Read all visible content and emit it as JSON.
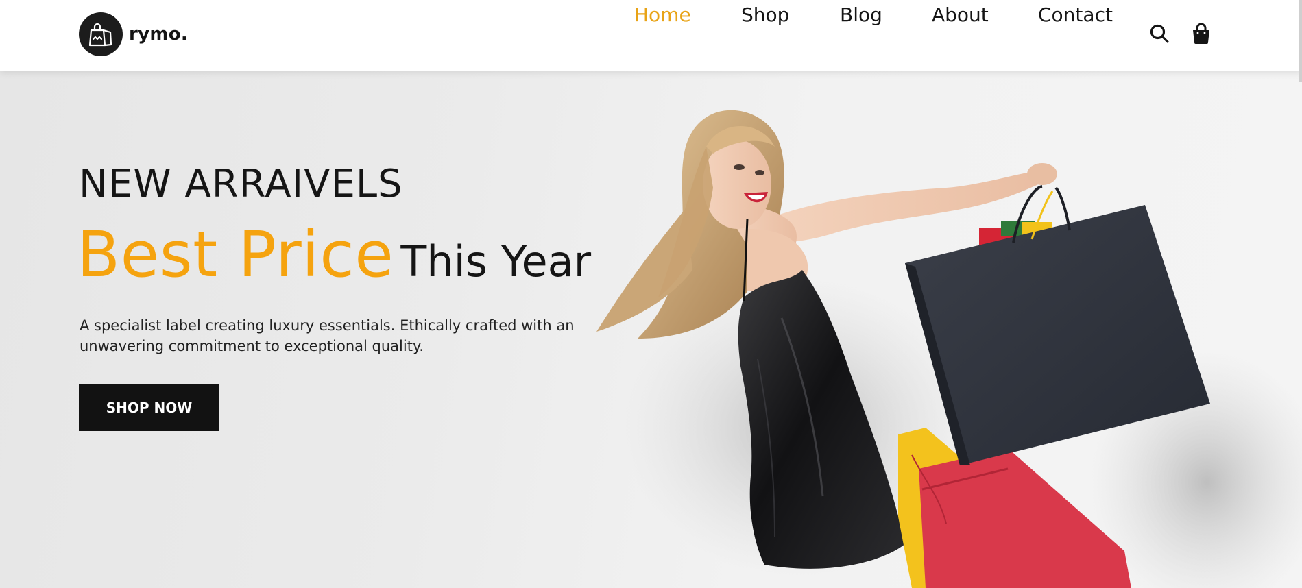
{
  "brand": {
    "name": "rymo."
  },
  "nav": {
    "items": [
      {
        "label": "Home",
        "active": true
      },
      {
        "label": "Shop",
        "active": false
      },
      {
        "label": "Blog",
        "active": false
      },
      {
        "label": "About",
        "active": false
      },
      {
        "label": "Contact",
        "active": false
      }
    ],
    "icons": [
      "search-icon",
      "shopping-bag-icon"
    ]
  },
  "hero": {
    "eyebrow": "NEW ARRAIVELS",
    "headline_accent": "Best Price",
    "headline_rest": "This Year",
    "description_line1": "A specialist label creating luxury essentials. Ethically crafted with an",
    "description_line2": "unwavering commitment to exceptional quality.",
    "cta_label": "SHOP NOW"
  },
  "colors": {
    "accent": "#f5a30f",
    "nav_active": "#e8a316",
    "dark": "#121212",
    "hero_bg": "#ececec"
  }
}
